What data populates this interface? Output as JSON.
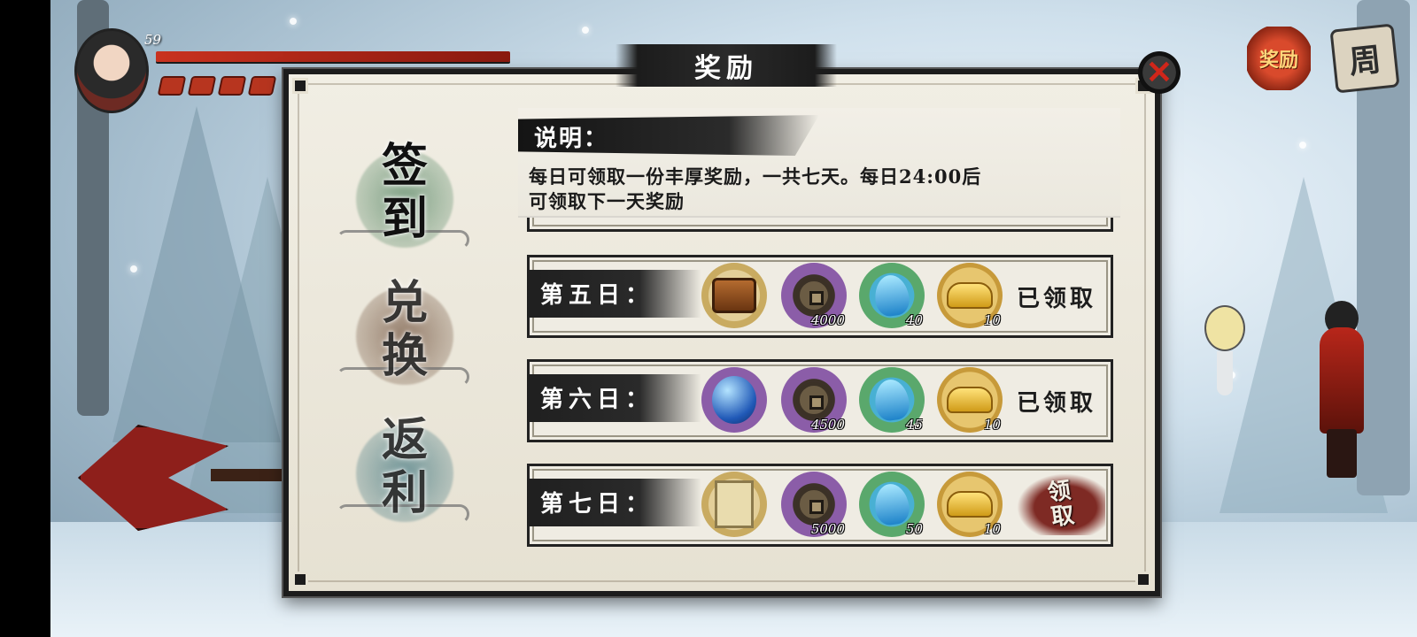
{
  "hud": {
    "level": "59",
    "reward_shortcut_label": "奖励",
    "week_shortcut_label": "周"
  },
  "modal": {
    "title": "奖励",
    "close_icon": "close-icon",
    "tabs": [
      {
        "label_line1": "签",
        "label_line2": "到",
        "ink_color": "#5d8b6a"
      },
      {
        "label_line1": "兑",
        "label_line2": "换",
        "ink_color": "#7a5d49"
      },
      {
        "label_line1": "返",
        "label_line2": "利",
        "ink_color": "#4c7d85"
      }
    ],
    "info": {
      "heading": "说明：",
      "line1": "每日可领取一份丰厚奖励，一共七天。每日24:00后",
      "line2": "可领取下一天奖励"
    },
    "rows": [
      {
        "day": "第五日：",
        "items": [
          {
            "icon": "treasure-chest-icon",
            "qty": ""
          },
          {
            "icon": "copper-coin-icon",
            "qty": "4000"
          },
          {
            "icon": "blue-flame-icon",
            "qty": "40"
          },
          {
            "icon": "gold-ingot-icon",
            "qty": "10"
          }
        ],
        "status": "已领取"
      },
      {
        "day": "第六日：",
        "items": [
          {
            "icon": "blue-orb-icon",
            "qty": ""
          },
          {
            "icon": "copper-coin-icon",
            "qty": "4500"
          },
          {
            "icon": "blue-flame-icon",
            "qty": "45"
          },
          {
            "icon": "gold-ingot-icon",
            "qty": "10"
          }
        ],
        "status": "已领取"
      },
      {
        "day": "第七日：",
        "items": [
          {
            "icon": "scroll-book-icon",
            "qty": ""
          },
          {
            "icon": "copper-coin-icon",
            "qty": "5000"
          },
          {
            "icon": "blue-flame-icon",
            "qty": "50"
          },
          {
            "icon": "gold-ingot-icon",
            "qty": "10"
          }
        ],
        "claim_label_line1": "领",
        "claim_label_line2": "取"
      }
    ]
  }
}
